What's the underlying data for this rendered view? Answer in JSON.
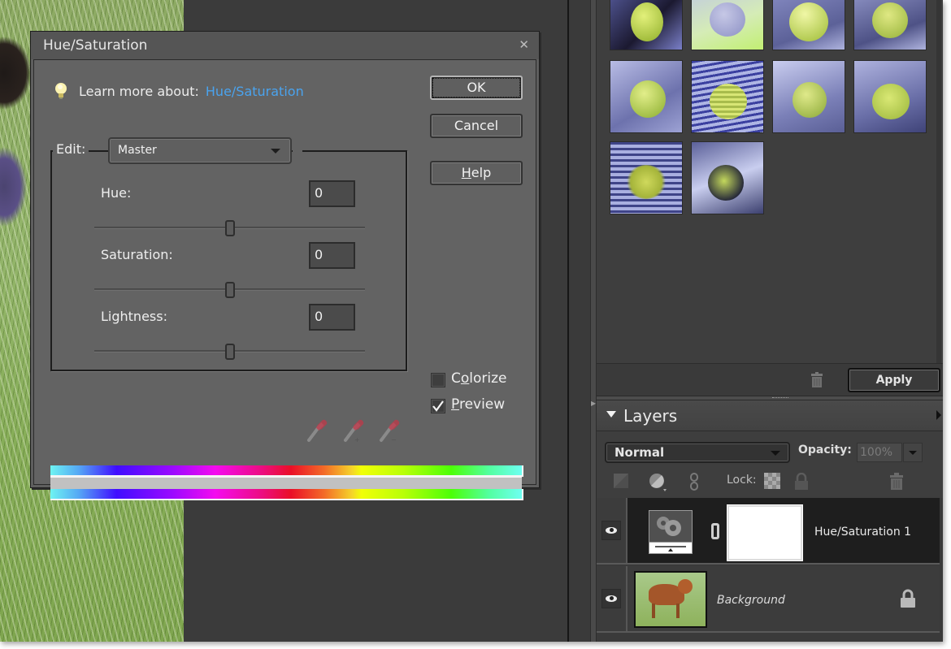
{
  "dialog": {
    "title": "Hue/Saturation",
    "close_icon": "close-icon",
    "learn_more_label": "Learn more about:",
    "learn_more_link": "Hue/Saturation",
    "buttons": {
      "ok": "OK",
      "cancel": "Cancel",
      "help_mnemonic": "H",
      "help_rest": "elp"
    },
    "edit": {
      "label": "Edit:",
      "selected": "Master"
    },
    "adjustments": [
      {
        "label": "Hue:",
        "value": "0",
        "range": [
          -180,
          180
        ]
      },
      {
        "label": "Saturation:",
        "value": "0",
        "range": [
          -100,
          100
        ]
      },
      {
        "label": "Lightness:",
        "value": "0",
        "range": [
          -100,
          100
        ]
      }
    ],
    "eyedroppers": [
      "eyedropper-icon",
      "eyedropper-plus-icon",
      "eyedropper-minus-icon"
    ],
    "colorize": {
      "pre": "C",
      "mnemonic": "o",
      "post": "lorize",
      "checked": false
    },
    "preview": {
      "mnemonic": "P",
      "post": "review",
      "checked": true
    },
    "link_color": "#4aa3ee"
  },
  "effects_panel": {
    "thumbnail_count": 10,
    "apply_label": "Apply"
  },
  "layers_panel": {
    "title": "Layers",
    "blend_mode": "Normal",
    "opacity_label": "Opacity:",
    "opacity_value": "100%",
    "lock_label": "Lock:",
    "layers": [
      {
        "name": "Hue/Saturation 1",
        "type": "adjustment",
        "visible": true,
        "selected": true
      },
      {
        "name": "Background",
        "type": "image",
        "visible": true,
        "locked": true,
        "selected": false
      }
    ]
  }
}
